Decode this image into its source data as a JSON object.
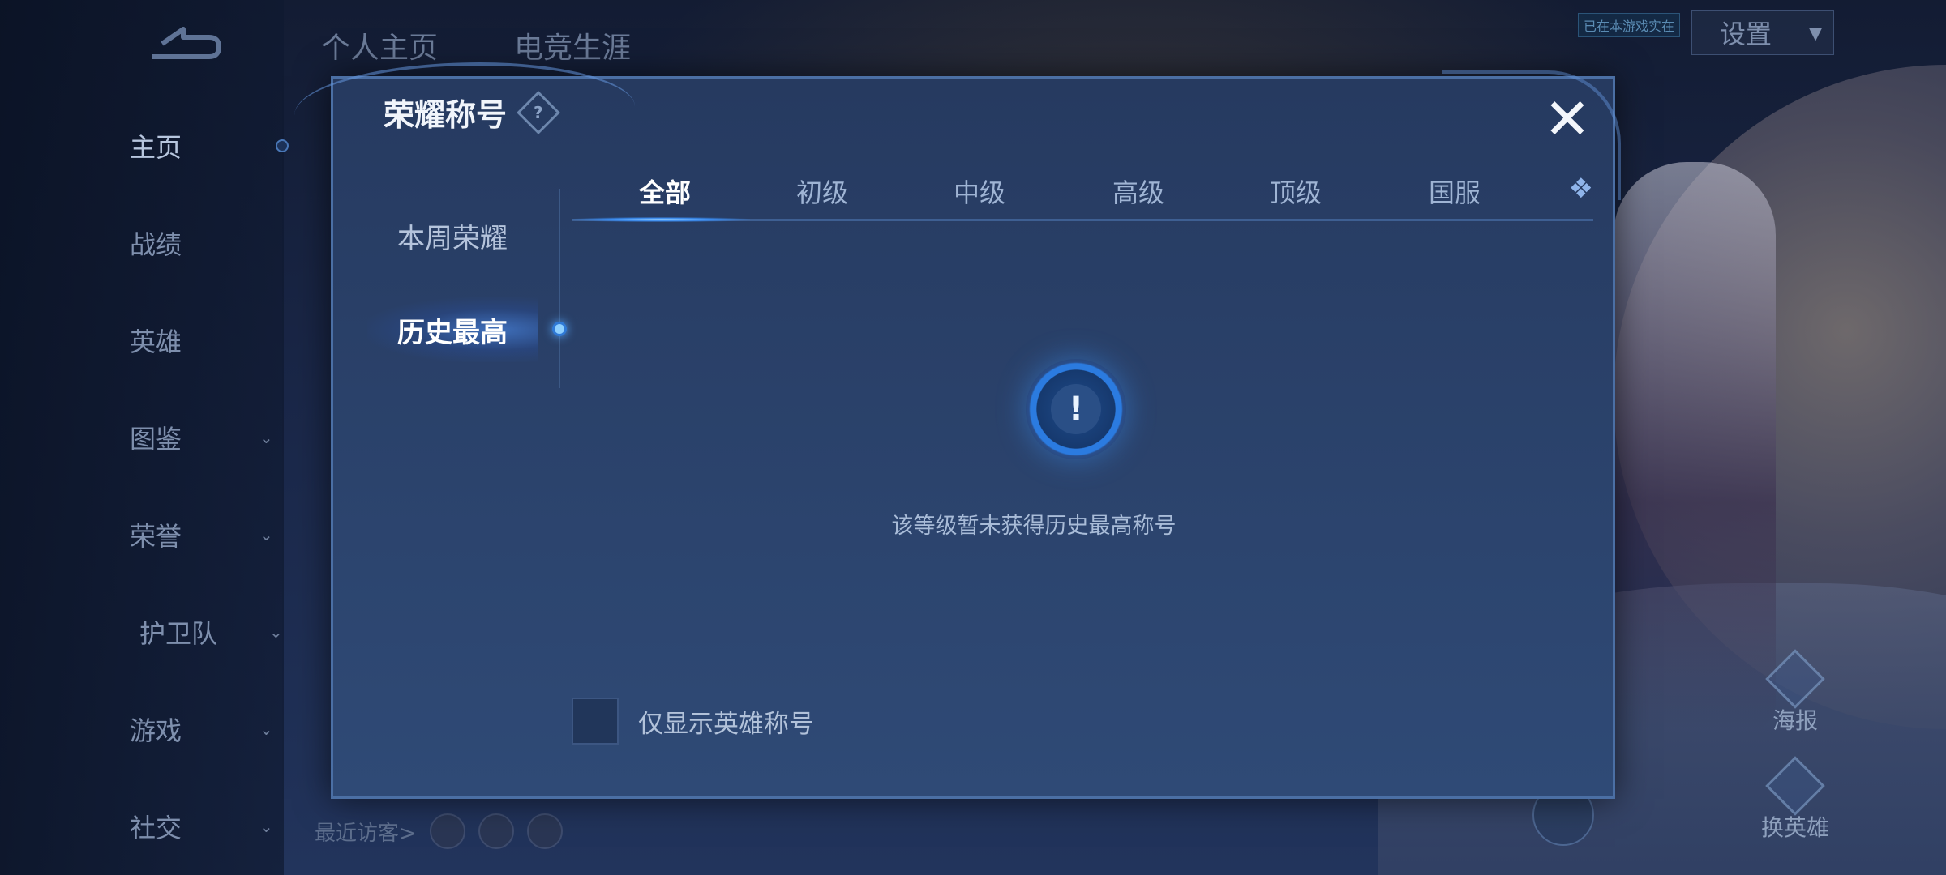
{
  "nav": {
    "items": [
      {
        "label": "主页",
        "has_chevron": false
      },
      {
        "label": "战绩",
        "has_chevron": false
      },
      {
        "label": "英雄",
        "has_chevron": false
      },
      {
        "label": "图鉴",
        "has_chevron": true
      },
      {
        "label": "荣誉",
        "has_chevron": true
      },
      {
        "label": "护卫队",
        "has_chevron": true
      },
      {
        "label": "游戏",
        "has_chevron": true
      },
      {
        "label": "社交",
        "has_chevron": true
      }
    ],
    "chevron_glyph": "⌄"
  },
  "top_tabs": [
    "个人主页",
    "电竞生涯"
  ],
  "sync_badge": "已在本游戏实在",
  "settings": {
    "label": "设置",
    "chevron": "▾"
  },
  "side_actions": [
    {
      "label": "海报",
      "icon": "poster-icon"
    },
    {
      "label": "换英雄",
      "icon": "switch-hero-icon"
    }
  ],
  "visitors": {
    "label": "最近访客>"
  },
  "modal": {
    "title": "荣耀称号",
    "help_glyph": "?",
    "close_glyph": "✕",
    "side_tabs": [
      {
        "label": "本周荣耀",
        "active": false
      },
      {
        "label": "历史最高",
        "active": true
      }
    ],
    "level_tabs": [
      {
        "label": "全部",
        "active": true
      },
      {
        "label": "初级",
        "active": false
      },
      {
        "label": "中级",
        "active": false
      },
      {
        "label": "高级",
        "active": false
      },
      {
        "label": "顶级",
        "active": false
      },
      {
        "label": "国服",
        "active": false
      }
    ],
    "more_glyph": "❖",
    "empty_icon_glyph": "!",
    "empty_message": "该等级暂未获得历史最高称号",
    "checkbox": {
      "label": "仅显示英雄称号",
      "checked": false
    }
  },
  "colors": {
    "accent": "#3a8bf0",
    "panel": "#2b4470",
    "text_primary": "#ffffff",
    "text_secondary": "#a9bcd8"
  }
}
